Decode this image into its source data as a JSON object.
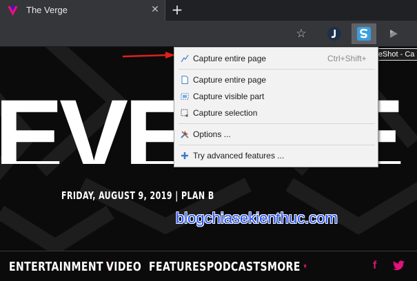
{
  "browser": {
    "tab_title": "The Verge",
    "tab_close_glyph": "✕",
    "new_tab_glyph": "+",
    "bookmark_glyph": "☆",
    "extensions": [
      "j-extension-icon",
      "fireshot-icon",
      "play-extension-icon"
    ],
    "tooltip": "FireShot - Ca"
  },
  "menu": {
    "items": [
      {
        "label": "Capture entire page",
        "shortcut": "Ctrl+Shift+",
        "icon": "capture-entire-quick-icon"
      },
      {
        "label": "Capture entire page",
        "icon": "page-icon"
      },
      {
        "label": "Capture visible part",
        "icon": "visible-part-icon"
      },
      {
        "label": "Capture selection",
        "icon": "selection-icon"
      },
      {
        "label": "Options ...",
        "icon": "tools-icon"
      },
      {
        "label": "Try advanced features ...",
        "icon": "plus-icon"
      }
    ]
  },
  "page": {
    "masthead": "EVERGE",
    "dateline": "FRIDAY, AUGUST 9, 2019 | PLAN B",
    "watermark": "blogchiasekienthuc.com",
    "nav": [
      {
        "label": "ENTERTAINMENT",
        "has_caret": true
      },
      {
        "label": "VIDEO"
      },
      {
        "label": "FEATURES"
      },
      {
        "label": "PODCASTS"
      },
      {
        "label": "MORE",
        "has_caret": true
      }
    ],
    "caret_glyph": "▾",
    "social": [
      "f",
      "twitter"
    ]
  },
  "colors": {
    "accent": "#e2127a",
    "watermark": "#1f4fff",
    "arrow": "#e0201c",
    "chrome_dark": "#202124",
    "toolbar": "#35363a"
  }
}
